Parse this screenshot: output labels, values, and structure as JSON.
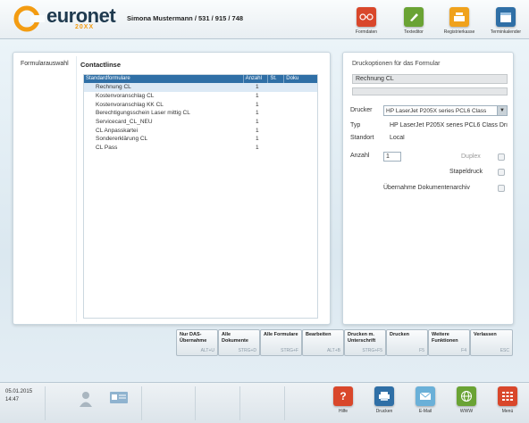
{
  "header": {
    "brand": "euronet",
    "brand_sub": "20XX",
    "user": "Simona Mustermann / 531 / 915 / 748",
    "buttons": [
      {
        "label": "Formdaten",
        "icon": "glasses-icon",
        "color": "#d9472b"
      },
      {
        "label": "Texteditor",
        "icon": "pencil-icon",
        "color": "#6aa334"
      },
      {
        "label": "Registrierkasse",
        "icon": "cash-register-icon",
        "color": "#f0a21c"
      },
      {
        "label": "Terminkalender",
        "icon": "calendar-icon",
        "color": "#2f6fa6"
      }
    ]
  },
  "left_panel": {
    "tab": "Formularauswahl",
    "heading": "Contactlinse",
    "columns": [
      "Standardformulare",
      "Anzahl",
      "St.",
      "Doku"
    ],
    "rows": [
      {
        "name": "Rechnung CL",
        "count": "1"
      },
      {
        "name": "Kostenvoranschlag CL",
        "count": "1"
      },
      {
        "name": "Kostenvoranschlag KK CL",
        "count": "1"
      },
      {
        "name": "Berechtigungsschein Laser mittig CL",
        "count": "1"
      },
      {
        "name": "Servicecard_CL_NEU",
        "count": "1"
      },
      {
        "name": "CL Anpasskartei",
        "count": "1"
      },
      {
        "name": "Sondererklärung CL",
        "count": "1"
      },
      {
        "name": "CL Pass",
        "count": "1"
      }
    ]
  },
  "right_panel": {
    "title": "Druckoptionen für das Formular",
    "form_name": "Rechnung CL",
    "drucker_label": "Drucker",
    "drucker_value": "HP LaserJet P205X series PCL6 Class",
    "typ_label": "Typ",
    "typ_value": "HP LaserJet P205X series PCL6 Class Dri",
    "standort_label": "Standort",
    "standort_value": "Local",
    "anzahl_label": "Anzahl",
    "anzahl_value": "1",
    "duplex_label": "Duplex",
    "stapeldruck_label": "Stapeldruck",
    "archiv_label": "Übernahme Dokumentenarchiv"
  },
  "function_keys": [
    {
      "label": "Nur DAS-Übernahme",
      "key": "ALT+U"
    },
    {
      "label": "Alle Dokumente",
      "key": "STRG+D"
    },
    {
      "label": "Alle Formulare",
      "key": "STRG+F"
    },
    {
      "label": "Bearbeiten",
      "key": "ALT+B"
    },
    {
      "label": "Drucken m. Unterschrift",
      "key": "STRG+F5"
    },
    {
      "label": "Drucken",
      "key": "F5"
    },
    {
      "label": "Weitere Funktionen",
      "key": "F4"
    },
    {
      "label": "Verlassen",
      "key": "ESC"
    }
  ],
  "footer": {
    "date": "05.01.2015",
    "time": "14:47",
    "buttons": [
      {
        "label": "Hilfe",
        "icon": "help-icon",
        "color": "#d9472b"
      },
      {
        "label": "Drucken",
        "icon": "printer-icon",
        "color": "#2f6fa6"
      },
      {
        "label": "E-Mail",
        "icon": "mail-icon",
        "color": "#6ab0d8"
      },
      {
        "label": "WWW",
        "icon": "globe-icon",
        "color": "#6aa334"
      },
      {
        "label": "Menü",
        "icon": "menu-grid-icon",
        "color": "#d9472b"
      }
    ]
  }
}
